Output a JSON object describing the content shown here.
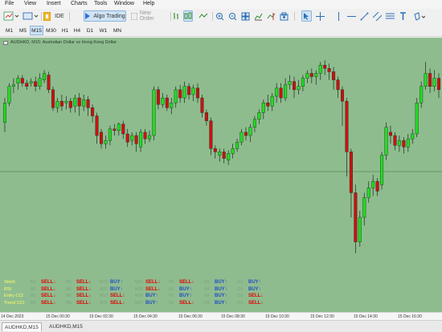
{
  "menu": [
    "File",
    "View",
    "Insert",
    "Charts",
    "Tools",
    "Window",
    "Help"
  ],
  "toolbar": {
    "ide_label": "IDE",
    "algo_label": "Algo Trading",
    "new_order_label": "New Order"
  },
  "timeframes": [
    "M1",
    "M5",
    "M15",
    "M30",
    "H1",
    "H4",
    "D1",
    "W1",
    "MN"
  ],
  "active_timeframe": "M15",
  "chart": {
    "title": "AUDHKD, M15:  Australian Dollar vs Hong Kong Dollar",
    "background": "#8fbc8f",
    "bull_color": "#22dd22",
    "bear_color": "#cc1111"
  },
  "indicator": {
    "rows": [
      {
        "label": "Stoch",
        "signals": [
          "SELL",
          "SELL",
          "BUY",
          "SELL",
          "SELL",
          "BUY",
          "BUY"
        ]
      },
      {
        "label": "RSI",
        "signals": [
          "SELL",
          "SELL",
          "BUY",
          "SELL",
          "BUY",
          "BUY",
          "BUY"
        ]
      },
      {
        "label": "Entry CCI",
        "signals": [
          "SELL",
          "SELL",
          "SELL",
          "BUY",
          "BUY",
          "BUY",
          "SELL"
        ]
      },
      {
        "label": "Trend CCI",
        "signals": [
          "SELL",
          "SELL",
          "SELL",
          "BUY",
          "SELL",
          "BUY",
          "SELL"
        ]
      }
    ],
    "timeframes": [
      "M1",
      "M5",
      "M15",
      "M30",
      "H1",
      "H4",
      "D1"
    ]
  },
  "x_axis": [
    "14 Dec 2023",
    "15 Dec 00:30",
    "15 Dec 02:30",
    "15 Dec 04:30",
    "15 Dec 06:30",
    "15 Dec 08:30",
    "15 Dec 10:30",
    "15 Dec 12:30",
    "15 Dec 14:30",
    "15 Dec 16:30"
  ],
  "tabs": [
    "AUDHKD,M15",
    "AUDHKD,M15"
  ],
  "candles": [
    [
      0.18,
      0.3,
      0.12,
      0.33
    ],
    [
      0.3,
      0.4,
      0.28,
      0.42
    ],
    [
      0.4,
      0.41,
      0.36,
      0.45
    ],
    [
      0.42,
      0.45,
      0.38,
      0.47
    ],
    [
      0.45,
      0.42,
      0.4,
      0.47
    ],
    [
      0.42,
      0.4,
      0.38,
      0.44
    ],
    [
      0.42,
      0.43,
      0.4,
      0.45
    ],
    [
      0.43,
      0.4,
      0.37,
      0.46
    ],
    [
      0.4,
      0.45,
      0.38,
      0.48
    ],
    [
      0.44,
      0.48,
      0.42,
      0.5
    ],
    [
      0.47,
      0.38,
      0.36,
      0.49
    ],
    [
      0.38,
      0.27,
      0.25,
      0.4
    ],
    [
      0.27,
      0.31,
      0.24,
      0.33
    ],
    [
      0.31,
      0.28,
      0.25,
      0.35
    ],
    [
      0.3,
      0.31,
      0.26,
      0.34
    ],
    [
      0.31,
      0.27,
      0.24,
      0.33
    ],
    [
      0.28,
      0.33,
      0.24,
      0.35
    ],
    [
      0.33,
      0.28,
      0.22,
      0.36
    ],
    [
      0.28,
      0.32,
      0.25,
      0.35
    ],
    [
      0.32,
      0.27,
      0.22,
      0.34
    ],
    [
      0.27,
      0.22,
      0.18,
      0.29
    ],
    [
      0.22,
      0.1,
      0.05,
      0.24
    ],
    [
      0.12,
      0.05,
      0.02,
      0.14
    ],
    [
      0.05,
      0.07,
      0.02,
      0.1
    ],
    [
      0.07,
      0.14,
      0.04,
      0.16
    ],
    [
      0.14,
      0.13,
      0.1,
      0.17
    ],
    [
      0.13,
      0.17,
      0.1,
      0.18
    ],
    [
      0.17,
      0.11,
      0.08,
      0.19
    ],
    [
      0.11,
      0.06,
      0.03,
      0.14
    ],
    [
      0.07,
      0.1,
      0.04,
      0.12
    ],
    [
      0.1,
      0.05,
      0.0,
      0.12
    ],
    [
      0.03,
      0.12,
      0.0,
      0.14
    ],
    [
      0.12,
      0.08,
      0.05,
      0.14
    ],
    [
      0.08,
      0.1,
      0.06,
      0.13
    ],
    [
      0.1,
      0.38,
      0.07,
      0.4
    ],
    [
      0.38,
      0.29,
      0.26,
      0.4
    ],
    [
      0.29,
      0.33,
      0.27,
      0.36
    ],
    [
      0.33,
      0.27,
      0.25,
      0.35
    ],
    [
      0.27,
      0.3,
      0.23,
      0.33
    ],
    [
      0.3,
      0.38,
      0.27,
      0.4
    ],
    [
      0.38,
      0.33,
      0.3,
      0.41
    ],
    [
      0.33,
      0.4,
      0.3,
      0.43
    ],
    [
      0.4,
      0.35,
      0.32,
      0.42
    ],
    [
      0.35,
      0.39,
      0.31,
      0.41
    ],
    [
      0.39,
      0.33,
      0.3,
      0.42
    ],
    [
      0.33,
      0.24,
      0.21,
      0.35
    ],
    [
      0.24,
      0.19,
      0.16,
      0.26
    ],
    [
      0.19,
      0.02,
      -0.02,
      0.21
    ],
    [
      0.02,
      0.0,
      -0.04,
      0.04
    ],
    [
      -0.02,
      0.0,
      -0.06,
      0.02
    ],
    [
      0.0,
      -0.04,
      -0.07,
      0.02
    ],
    [
      -0.05,
      -0.01,
      -0.08,
      0.01
    ],
    [
      -0.01,
      0.02,
      -0.04,
      0.05
    ],
    [
      0.02,
      0.06,
      0.0,
      0.08
    ],
    [
      0.06,
      0.12,
      0.04,
      0.14
    ],
    [
      0.12,
      0.1,
      0.07,
      0.15
    ],
    [
      0.1,
      0.15,
      0.06,
      0.17
    ],
    [
      0.15,
      0.2,
      0.12,
      0.22
    ],
    [
      0.2,
      0.24,
      0.17,
      0.26
    ],
    [
      0.24,
      0.3,
      0.2,
      0.32
    ],
    [
      0.3,
      0.28,
      0.25,
      0.35
    ],
    [
      0.28,
      0.34,
      0.25,
      0.36
    ],
    [
      0.34,
      0.39,
      0.3,
      0.42
    ],
    [
      0.39,
      0.33,
      0.3,
      0.42
    ],
    [
      0.33,
      0.41,
      0.31,
      0.45
    ],
    [
      0.41,
      0.43,
      0.38,
      0.47
    ],
    [
      0.43,
      0.38,
      0.33,
      0.46
    ],
    [
      0.38,
      0.4,
      0.35,
      0.44
    ],
    [
      0.4,
      0.45,
      0.37,
      0.47
    ],
    [
      0.45,
      0.48,
      0.42,
      0.5
    ],
    [
      0.48,
      0.46,
      0.42,
      0.51
    ],
    [
      0.46,
      0.48,
      0.41,
      0.5
    ],
    [
      0.48,
      0.53,
      0.44,
      0.55
    ],
    [
      0.53,
      0.51,
      0.47,
      0.56
    ],
    [
      0.51,
      0.49,
      0.44,
      0.54
    ],
    [
      0.49,
      0.44,
      0.38,
      0.52
    ],
    [
      0.44,
      0.38,
      0.33,
      0.46
    ],
    [
      0.38,
      0.31,
      0.16,
      0.4
    ],
    [
      0.31,
      0.0,
      -0.15,
      0.33
    ],
    [
      0.0,
      -0.25,
      -0.4,
      0.02
    ],
    [
      -0.25,
      -0.55,
      -0.62,
      -0.2
    ],
    [
      -0.55,
      -0.4,
      -0.58,
      -0.36
    ],
    [
      -0.4,
      -0.28,
      -0.45,
      -0.25
    ],
    [
      -0.28,
      -0.22,
      -0.31,
      -0.18
    ],
    [
      -0.22,
      -0.18,
      -0.27,
      -0.14
    ],
    [
      -0.18,
      -0.24,
      -0.27,
      -0.16
    ],
    [
      -0.2,
      -0.02,
      -0.23,
      0.0
    ],
    [
      -0.02,
      0.15,
      -0.05,
      0.18
    ],
    [
      0.12,
      0.1,
      0.05,
      0.16
    ],
    [
      0.1,
      0.04,
      0.01,
      0.12
    ],
    [
      0.04,
      0.07,
      0.0,
      0.1
    ],
    [
      0.07,
      0.03,
      -0.01,
      0.09
    ],
    [
      0.03,
      0.08,
      0.0,
      0.11
    ],
    [
      0.08,
      0.11,
      0.05,
      0.14
    ],
    [
      0.11,
      0.3,
      0.09,
      0.33
    ],
    [
      0.3,
      0.4,
      0.27,
      0.43
    ],
    [
      0.4,
      0.48,
      0.38,
      0.55
    ],
    [
      0.48,
      0.4,
      0.36,
      0.51
    ],
    [
      0.4,
      0.45,
      0.37,
      0.5
    ],
    [
      0.45,
      0.38,
      0.33,
      0.48
    ]
  ]
}
